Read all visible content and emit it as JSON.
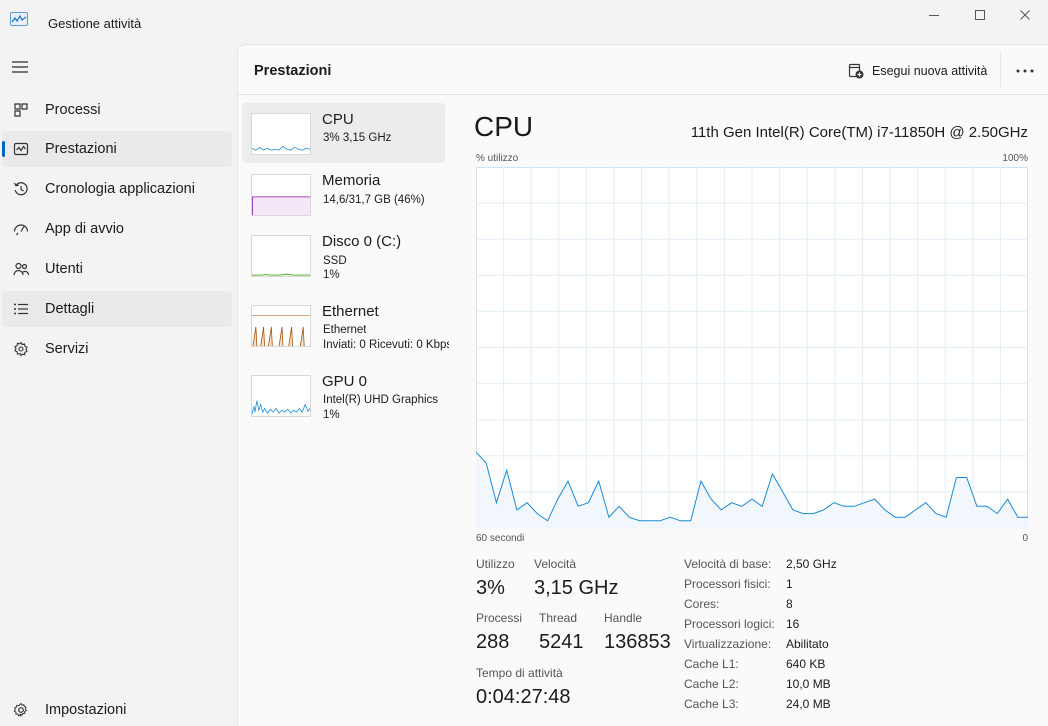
{
  "app": {
    "title": "Gestione attività",
    "icon": "task-manager-icon"
  },
  "sidebar": {
    "items": [
      {
        "label": "Processi",
        "icon": "processes-grid-icon"
      },
      {
        "label": "Prestazioni",
        "icon": "performance-graph-icon"
      },
      {
        "label": "Cronologia applicazioni",
        "icon": "history-clock-icon"
      },
      {
        "label": "App di avvio",
        "icon": "startup-speedometer-icon"
      },
      {
        "label": "Utenti",
        "icon": "users-icon"
      },
      {
        "label": "Dettagli",
        "icon": "details-list-icon"
      },
      {
        "label": "Servizi",
        "icon": "services-puzzle-icon"
      }
    ],
    "selected": "Prestazioni",
    "settings_label": "Impostazioni"
  },
  "header": {
    "title": "Prestazioni",
    "run_task_label": "Esegui nuova attività"
  },
  "resources": [
    {
      "name": "CPU",
      "line1": "3% 3,15 GHz",
      "line2": ""
    },
    {
      "name": "Memoria",
      "line1": "14,6/31,7 GB (46%)",
      "line2": ""
    },
    {
      "name": "Disco 0 (C:)",
      "line1": "SSD",
      "line2": "1%"
    },
    {
      "name": "Ethernet",
      "line1": "Ethernet",
      "line2": "Inviati: 0  Ricevuti: 0 Kbps"
    },
    {
      "name": "GPU 0",
      "line1": "Intel(R) UHD Graphics",
      "line2": "1%"
    }
  ],
  "detail": {
    "title": "CPU",
    "model": "11th Gen Intel(R) Core(TM) i7-11850H @ 2.50GHz",
    "graph_label": "% utilizzo",
    "graph_max": "100%",
    "time_span": "60 secondi",
    "time_end": "0",
    "utilization_label": "Utilizzo",
    "utilization_value": "3%",
    "speed_label": "Velocità",
    "speed_value": "3,15 GHz",
    "processes_label": "Processi",
    "processes_value": "288",
    "threads_label": "Thread",
    "threads_value": "5241",
    "handles_label": "Handle",
    "handles_value": "136853",
    "uptime_label": "Tempo di attività",
    "uptime_value": "0:04:27:48",
    "specs": [
      {
        "label": "Velocità di base:",
        "value": "2,50 GHz"
      },
      {
        "label": "Processori fisici:",
        "value": "1"
      },
      {
        "label": "Cores:",
        "value": "8"
      },
      {
        "label": "Processori logici:",
        "value": "16"
      },
      {
        "label": "Virtualizzazione:",
        "value": "Abilitato"
      },
      {
        "label": "Cache L1:",
        "value": "640 KB"
      },
      {
        "label": "Cache L2:",
        "value": "10,0 MB"
      },
      {
        "label": "Cache L3:",
        "value": "24,0 MB"
      }
    ]
  },
  "colors": {
    "cpu": "#1a8ad4",
    "memory": "#8b12ae",
    "disk": "#4da60c",
    "ethernet": "#a74f01",
    "gpu": "#1a8ad4",
    "accent": "#0067c0"
  },
  "chart_data": {
    "type": "area",
    "ylim": [
      0,
      100
    ],
    "x_points": 60,
    "values": [
      21,
      18,
      7,
      16,
      5,
      7,
      4,
      2,
      8,
      13,
      6,
      7,
      13,
      3,
      6,
      3,
      2,
      2,
      2,
      3,
      2,
      2,
      13,
      8,
      5,
      7,
      6,
      8,
      6,
      15,
      10,
      5,
      4,
      4,
      5,
      7,
      6,
      6,
      7,
      8,
      5,
      3,
      3,
      5,
      7,
      4,
      3,
      14,
      14,
      6,
      6,
      4,
      8,
      3,
      3
    ]
  }
}
